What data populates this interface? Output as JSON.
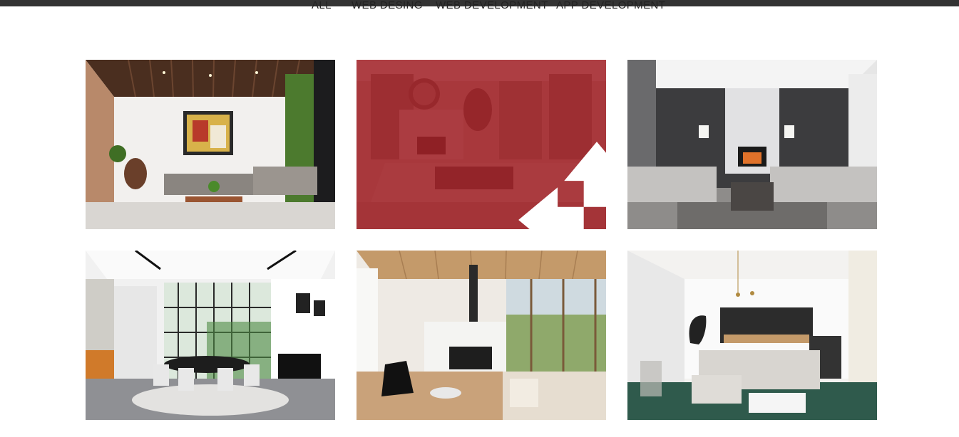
{
  "filters": [
    "ALL",
    "WEB DESING",
    "WEB DEVELOPMENT",
    "APP DEVELOPMENT"
  ],
  "gallery": {
    "items": [
      {
        "subject": "living room with wooden slatted ceiling and green wall"
      },
      {
        "subject": "living room with fireplace",
        "hovered": true,
        "icon": "move-icon"
      },
      {
        "subject": "grey living room with fireplace"
      },
      {
        "subject": "dining room with round table"
      },
      {
        "subject": "living room with central fireplace and wood ceiling"
      },
      {
        "subject": "white living room with sectional sofa"
      }
    ]
  },
  "colors": {
    "topbar": "#333333",
    "hover_overlay": "#a01e24",
    "filter_text": "#222222"
  }
}
